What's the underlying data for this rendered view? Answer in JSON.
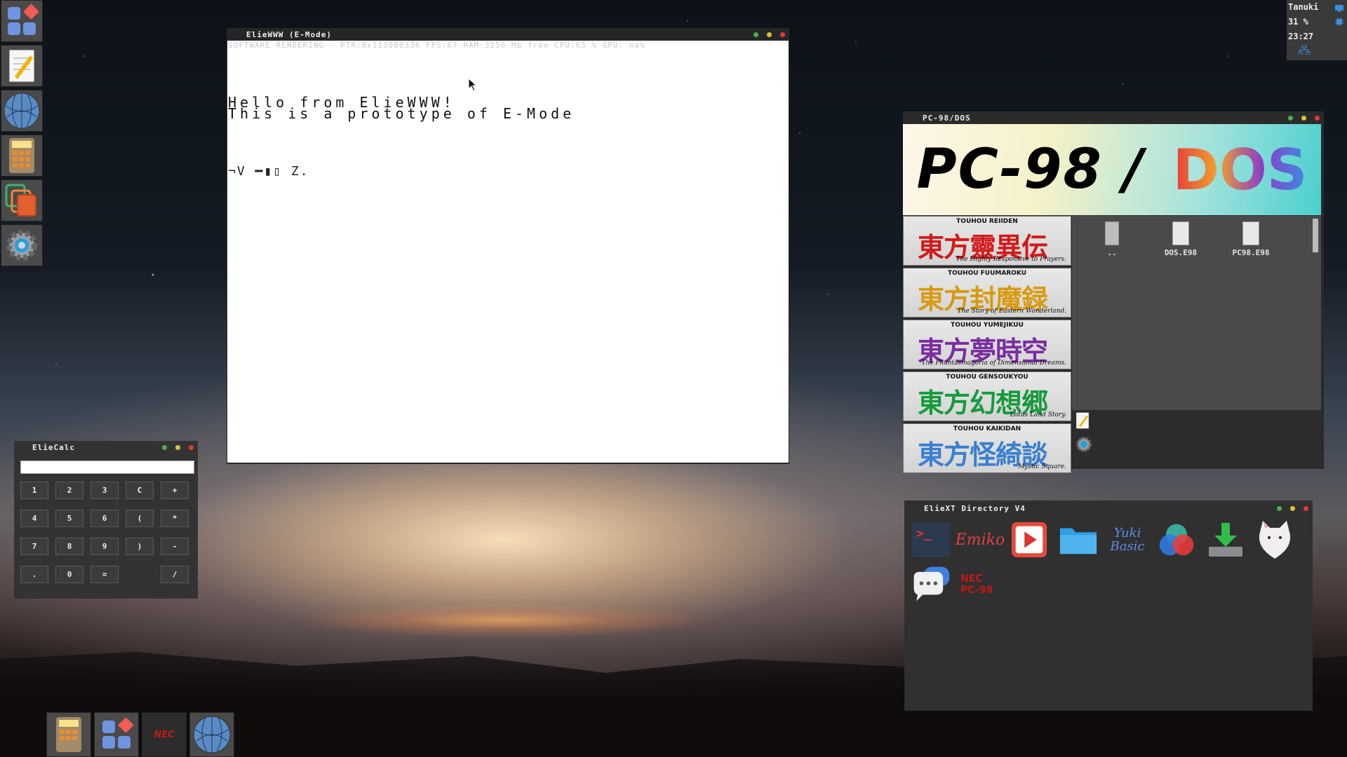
{
  "tray": {
    "user": "Tanuki",
    "battery": "31 %",
    "time": "23:27"
  },
  "dock_left": [
    {
      "name": "apps-grid-icon"
    },
    {
      "name": "notepad-icon"
    },
    {
      "name": "globe-icon"
    },
    {
      "name": "calculator-icon"
    },
    {
      "name": "windows-icon"
    },
    {
      "name": "settings-gear-icon"
    }
  ],
  "dock_bottom": [
    {
      "name": "calculator-icon"
    },
    {
      "name": "apps-grid-icon"
    },
    {
      "name": "pc98-icon",
      "label": "NEC"
    },
    {
      "name": "globe-icon"
    }
  ],
  "browser": {
    "title": "ElieWWW (E-Mode)",
    "status": "SOFTWARE RENDERING - PTR:0x113080336 FPS:67 RAM:3256 Mb free  CPU:65 % GPU: na%",
    "line1": "Hello from ElieWWW!",
    "line2": "This is a prototype of E-Mode",
    "glyphs": "¬V ━▮▯ Z."
  },
  "pc98": {
    "title": "PC-98/DOS",
    "banner_text": "PC-98 / ",
    "banner_logo": "DOS",
    "games": [
      {
        "subtitle": "TOUHOU REIIDEN",
        "title": "東方靈異伝",
        "tagline": "The Highly Responsive to Prayers.",
        "color": "#d21a1a"
      },
      {
        "subtitle": "TOUHOU FUUMAROKU",
        "title": "東方封魔録",
        "tagline": "The Story of Eastern Wonderland.",
        "color": "#d79b12"
      },
      {
        "subtitle": "TOUHOU YUMEJIKUU",
        "title": "東方夢時空",
        "tagline": "The Phantasmagoria of Dimensional Dreams.",
        "color": "#7a2da0"
      },
      {
        "subtitle": "TOUHOU GENSOUKYOU",
        "title": "東方幻想郷",
        "tagline": "Lotus Land Story.",
        "color": "#179a3c"
      },
      {
        "subtitle": "TOUHOU KAIKIDAN",
        "title": "東方怪綺談",
        "tagline": "Mystic Square.",
        "color": "#3a7fd0"
      }
    ],
    "files": [
      {
        "name": "..",
        "icon": "folder-up-icon"
      },
      {
        "name": "DOS.E98",
        "icon": "file-icon"
      },
      {
        "name": "PC98.E98",
        "icon": "file-icon"
      }
    ]
  },
  "calc": {
    "title": "ElieCalc",
    "display": "",
    "keys": [
      [
        "1",
        "2",
        "3",
        "C",
        "+"
      ],
      [
        "4",
        "5",
        "6",
        "(",
        "*"
      ],
      [
        "7",
        "8",
        "9",
        ")",
        "-"
      ],
      [
        ".",
        "0",
        "=",
        "",
        "/"
      ]
    ]
  },
  "directory": {
    "title": "ElieXT Directory V4",
    "apps": [
      {
        "name": "terminal-app-icon",
        "label": ">_"
      },
      {
        "name": "emiko-app-icon",
        "label": "Emiko"
      },
      {
        "name": "media-player-app-icon",
        "label": ""
      },
      {
        "name": "folder-app-icon",
        "label": ""
      },
      {
        "name": "yuki-basic-app-icon",
        "label": "Yuki Basic"
      },
      {
        "name": "color-circles-app-icon",
        "label": ""
      },
      {
        "name": "download-app-icon",
        "label": ""
      },
      {
        "name": "cat-app-icon",
        "label": ""
      },
      {
        "name": "chat-app-icon",
        "label": ""
      },
      {
        "name": "pc98-app-icon",
        "label": "NEC PC-98"
      }
    ]
  }
}
